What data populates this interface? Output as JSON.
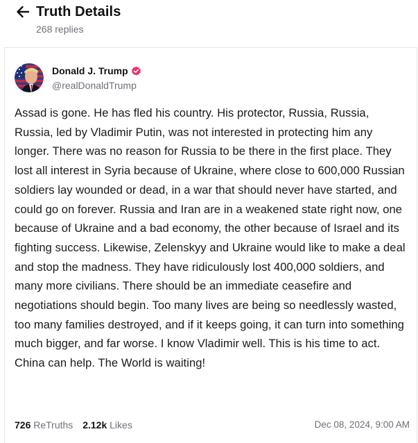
{
  "header": {
    "back_icon": "arrow-left-icon",
    "title": "Truth Details",
    "reply_count": "268 replies"
  },
  "post": {
    "author": {
      "name": "Donald J. Trump",
      "handle": "@realDonaldTrump",
      "verified_icon": "verified-badge-icon",
      "avatar_icon": "avatar-image"
    },
    "body": "Assad is gone. He has fled his country. His protector, Russia, Russia, Russia, led by Vladimir Putin, was not interested in protecting him any longer. There was no reason for Russia to be there in the first place. They lost all interest in Syria because of Ukraine, where close to 600,000 Russian soldiers lay wounded or dead, in a war that should never have started, and could go on forever. Russia and Iran are in a weakened state right now, one because of Ukraine and a bad economy, the other because of Israel and its fighting success. Likewise, Zelenskyy and Ukraine would like to make a deal and stop the madness. They have ridiculously lost 400,000 soldiers, and many more civilians. There should be an immediate ceasefire and negotiations should begin. Too many lives are being so needlessly wasted, too many families destroyed, and if it keeps going, it can turn into something much bigger, and far worse. I know Vladimir well. This is his time to act. China can help. The World is waiting!",
    "stats": {
      "retruths_count": "726",
      "retruths_label": "ReTruths",
      "likes_count": "2.12k",
      "likes_label": "Likes"
    },
    "timestamp": "Dec 08, 2024, 9:00 AM"
  },
  "colors": {
    "verified_badge": "#e8336d",
    "muted_text": "#6f6f7a",
    "border": "#e6e6ea"
  }
}
